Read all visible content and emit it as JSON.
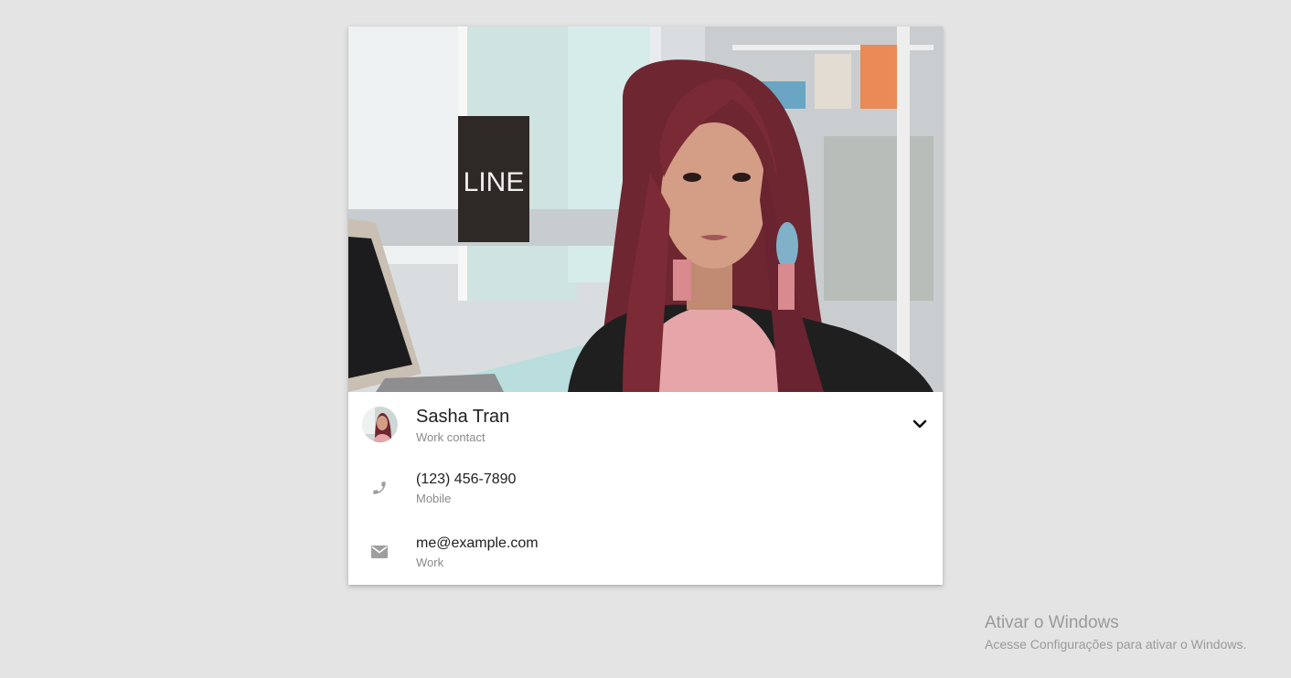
{
  "contact": {
    "name": "Sasha Tran",
    "subtitle": "Work contact",
    "phone": {
      "value": "(123) 456-7890",
      "label": "Mobile",
      "icon": "phone-icon"
    },
    "email": {
      "value": "me@example.com",
      "label": "Work",
      "icon": "email-icon"
    },
    "expand_icon": "chevron-down-icon"
  },
  "watermark": {
    "title": "Ativar o Windows",
    "subtitle": "Acesse Configurações para ativar o Windows."
  },
  "colors": {
    "background": "#e4e4e4",
    "card": "#ffffff",
    "primary_text": "#212121",
    "secondary_text": "#8a8a8a",
    "icon": "#9e9e9e"
  }
}
